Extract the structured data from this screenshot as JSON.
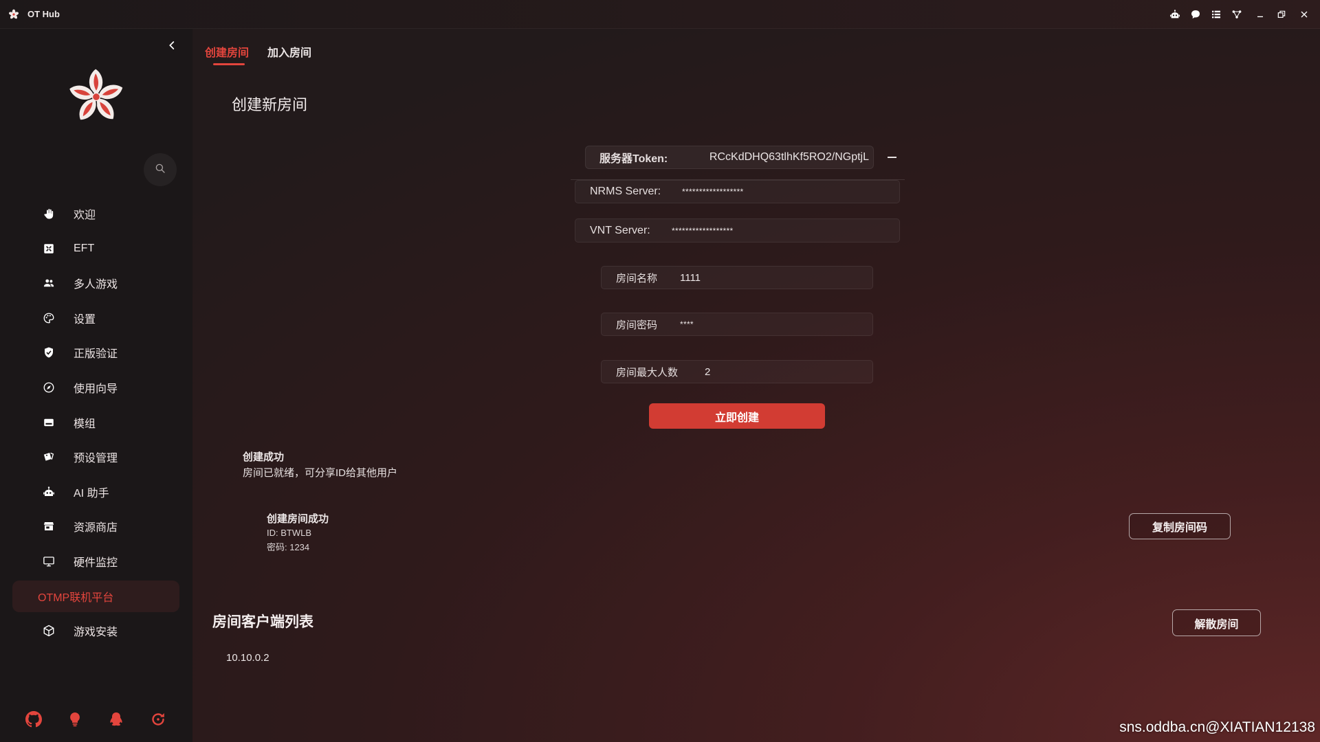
{
  "titlebar": {
    "title": "OT Hub",
    "logo_icon": "flower-logo-icon",
    "icons": [
      "robot-icon",
      "chat-icon",
      "list-icon",
      "network-icon",
      "minimize-icon",
      "restore-icon",
      "close-icon"
    ]
  },
  "sidebar": {
    "collapse_icon": "chevron-left-icon",
    "search_icon": "search-icon",
    "items": [
      {
        "label": "欢迎",
        "icon": "hand-icon"
      },
      {
        "label": "EFT",
        "icon": "eft-icon"
      },
      {
        "label": "多人游戏",
        "icon": "users-icon"
      },
      {
        "label": "设置",
        "icon": "palette-icon"
      },
      {
        "label": "正版验证",
        "icon": "shield-check-icon"
      },
      {
        "label": "使用向导",
        "icon": "compass-icon"
      },
      {
        "label": "模组",
        "icon": "card-icon"
      },
      {
        "label": "预设管理",
        "icon": "tag-icon"
      },
      {
        "label": "AI 助手",
        "icon": "robot-icon"
      },
      {
        "label": "资源商店",
        "icon": "store-icon"
      },
      {
        "label": "硬件监控",
        "icon": "monitor-icon"
      },
      {
        "label": "OTMP联机平台",
        "active": true
      },
      {
        "label": "游戏安装",
        "icon": "cube-icon"
      }
    ],
    "footer_icons": [
      "github-icon",
      "lightbulb-icon",
      "qq-icon",
      "refresh-icon"
    ]
  },
  "tabs": [
    {
      "label": "创建房间",
      "active": true
    },
    {
      "label": "加入房间",
      "active": false
    }
  ],
  "create": {
    "heading": "创建新房间",
    "token": {
      "label": "服务器Token:",
      "value": "RCcKdDHQ63tlhKf5RO2/NGptjL"
    },
    "nrms": {
      "label": "NRMS Server:",
      "value": "******************"
    },
    "vnt": {
      "label": "VNT Server:",
      "value": "******************"
    },
    "room_name": {
      "label": "房间名称",
      "value": "1111"
    },
    "room_password": {
      "label": "房间密码",
      "value": "****"
    },
    "max_players": {
      "label": "房间最大人数",
      "value": "2"
    },
    "submit_label": "立即创建"
  },
  "notice": {
    "title": "创建成功",
    "message": "房间已就绪，可分享ID给其他用户"
  },
  "room_info": {
    "title": "创建房间成功",
    "id": "ID: BTWLB",
    "password": "密码: 1234",
    "copy_label": "复制房间码"
  },
  "clients": {
    "heading": "房间客户端列表",
    "dismiss_label": "解散房间",
    "items": [
      "10.10.0.2"
    ]
  },
  "watermark": "sns.oddba.cn@XIATIAN12138",
  "colors": {
    "accent": "#e3453d",
    "primary_button": "#d23c33",
    "sidebar_bg": "#1b1718"
  }
}
